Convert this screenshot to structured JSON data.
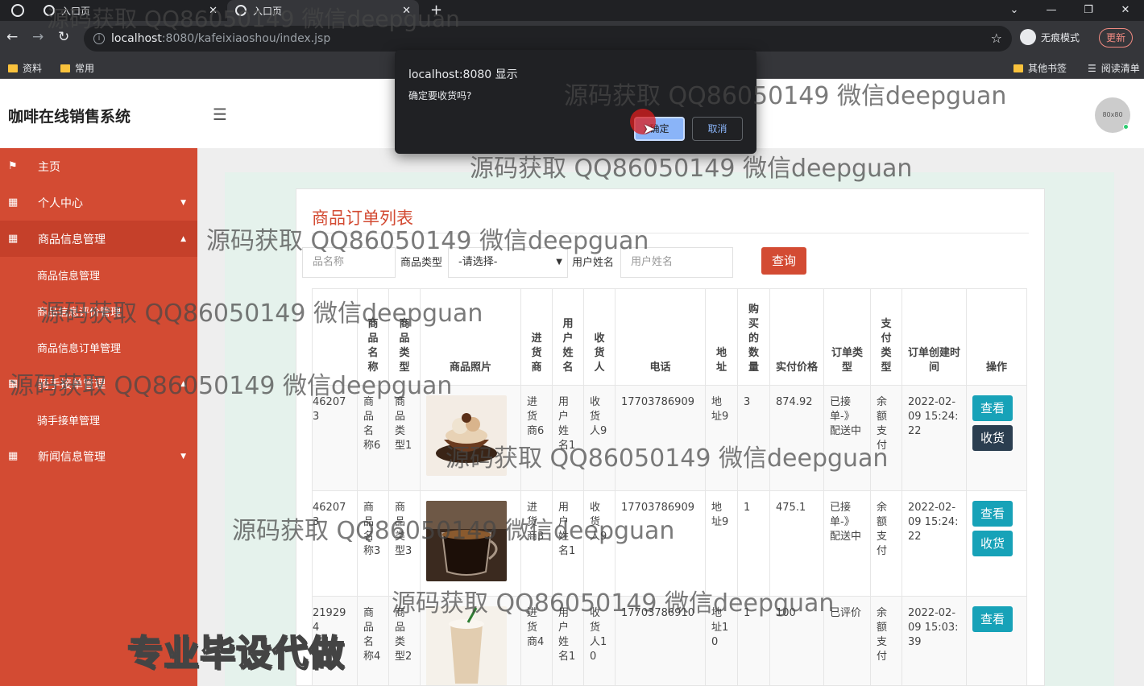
{
  "browser": {
    "tabs": [
      {
        "label": "入口页",
        "active": false
      },
      {
        "label": "入口页",
        "active": true
      }
    ],
    "new_tab": "+",
    "url_host": "localhost",
    "url_path": ":8080/kafeixiaoshou/index.jsp",
    "incognito_label": "无痕模式",
    "update_label": "更新",
    "bookmarks": [
      "资料",
      "常用"
    ],
    "bookmarks_right": [
      "其他书签",
      "阅读清单"
    ]
  },
  "app": {
    "title": "咖啡在线销售系统",
    "avatar_text": "80x80"
  },
  "sidebar": {
    "items": [
      {
        "label": "主页",
        "icon": "flag-icon"
      },
      {
        "label": "个人中心",
        "icon": "grid-icon"
      },
      {
        "label": "商品信息管理",
        "icon": "grid-icon"
      },
      {
        "label": "骑手接单管理",
        "icon": "grid-icon"
      },
      {
        "label": "新闻信息管理",
        "icon": "grid-icon"
      }
    ],
    "sub_items": [
      "商品信息管理",
      "商品信息评价管理",
      "商品信息订单管理",
      "骑手接单管理"
    ]
  },
  "page": {
    "title": "商品订单列表",
    "search": {
      "name_placeholder": "品名称",
      "type_label": "商品类型",
      "type_selected": "-请选择-",
      "user_label": "用户姓名",
      "user_placeholder": "用户姓名",
      "search_button": "查询"
    },
    "columns": [
      "",
      "商品名称",
      "商品类型",
      "商品照片",
      "进货商",
      "用户姓名",
      "收货人",
      "电话",
      "地址",
      "购买的数量",
      "实付价格",
      "订单类型",
      "支付类型",
      "订单创建时间",
      "操作"
    ],
    "rows": [
      {
        "id": "462073",
        "name": "商品名称6",
        "type": "商品类型1",
        "vendor": "进货商6",
        "user": "用户姓名1",
        "receiver": "收货人9",
        "phone": "17703786909",
        "address": "地址9",
        "qty": "3",
        "price": "874.92",
        "status": "已接单-》配送中",
        "pay": "余额支付",
        "created": "2022-02-09 15:24:22",
        "actions": [
          "查看",
          "收货"
        ]
      },
      {
        "id": "462073",
        "name": "商品名称3",
        "type": "商品类型3",
        "vendor": "进货商3",
        "user": "用户姓名1",
        "receiver": "收货人9",
        "phone": "17703786909",
        "address": "地址9",
        "qty": "1",
        "price": "475.1",
        "status": "已接单-》配送中",
        "pay": "余额支付",
        "created": "2022-02-09 15:24:22",
        "actions": [
          "查看",
          "收货"
        ]
      },
      {
        "id": "219294",
        "name": "商品名称4",
        "type": "商品类型2",
        "vendor": "进货商4",
        "user": "用户姓名1",
        "receiver": "收货人10",
        "phone": "17703786910",
        "address": "地址10",
        "qty": "1",
        "price": "100",
        "status": "已评价",
        "pay": "余额支付",
        "created": "2022-02-09 15:03:39",
        "actions": [
          "查看"
        ]
      }
    ]
  },
  "dialog": {
    "title": "localhost:8080 显示",
    "message": "确定要收货吗?",
    "ok": "确定",
    "cancel": "取消"
  },
  "overlay": {
    "watermark": "源码获取 QQ86050149 微信deepguan",
    "promo": "专业毕设代做"
  }
}
